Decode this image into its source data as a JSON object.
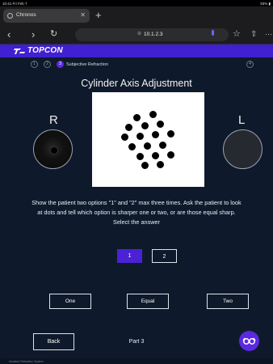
{
  "status_bar": {
    "time": "10:41  Fri Feb 7",
    "battery": "93% ▮"
  },
  "browser": {
    "tab_title": "Chronos",
    "url": "10.1.2.3"
  },
  "brand": "TOPCON",
  "stepper": {
    "steps": [
      "1",
      "2",
      "3"
    ],
    "last_step": "4",
    "active_label": "Subjective Refraction"
  },
  "heading": "Cylinder Axis Adjustment",
  "eyes": {
    "right": "R",
    "left": "L"
  },
  "instructions": "Show the patient two options \"1\" and \"2\" max three times. Ask the patient to look at dots and tell which option is sharper one or two, or are those equal sharp. Select the answer",
  "options": {
    "first": "1",
    "second": "2"
  },
  "answers": [
    "One",
    "Equal",
    "Two"
  ],
  "footer_nav": {
    "back": "Back",
    "part": "Part 3"
  },
  "footer_text": "Assisted Refraction System",
  "icons": [
    "chrome-tab-icon",
    "close-icon",
    "new-tab-icon",
    "back-arrow-icon",
    "forward-arrow-icon",
    "reload-icon",
    "lock-icon",
    "mic-icon",
    "bookmark-star-icon",
    "share-icon",
    "more-icon",
    "eye-glasses-icon"
  ],
  "colors": {
    "accent": "#4a22d4",
    "brand_bar": "#4020d0",
    "background": "#0e1a2b"
  }
}
